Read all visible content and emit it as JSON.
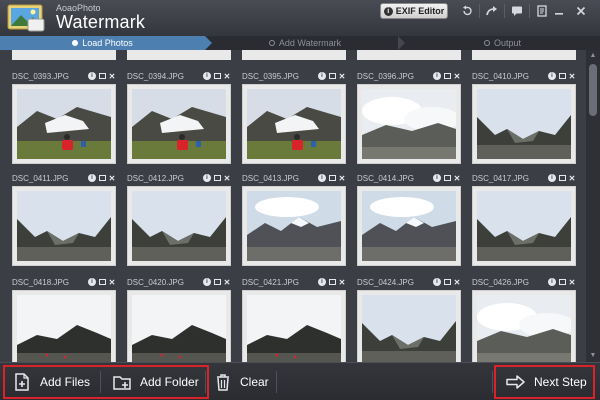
{
  "app": {
    "subtitle": "AoaoPhoto",
    "title": "Watermark"
  },
  "toolbar": {
    "exif_label": "EXIF Editor",
    "exif_icon": "info-icon"
  },
  "steps": [
    {
      "label": "Load Photos",
      "active": true
    },
    {
      "label": "Add Watermark",
      "active": false
    },
    {
      "label": "Output",
      "active": false
    }
  ],
  "photos": [
    {
      "name": "DSC_0393.JPG",
      "scene": "people"
    },
    {
      "name": "DSC_0394.JPG",
      "scene": "people"
    },
    {
      "name": "DSC_0395.JPG",
      "scene": "people"
    },
    {
      "name": "DSC_0396.JPG",
      "scene": "cloud"
    },
    {
      "name": "DSC_0410.JPG",
      "scene": "valley"
    },
    {
      "name": "DSC_0411.JPG",
      "scene": "valley"
    },
    {
      "name": "DSC_0412.JPG",
      "scene": "valley"
    },
    {
      "name": "DSC_0413.JPG",
      "scene": "snow"
    },
    {
      "name": "DSC_0414.JPG",
      "scene": "snow"
    },
    {
      "name": "DSC_0417.JPG",
      "scene": "valley"
    },
    {
      "name": "DSC_0418.JPG",
      "scene": "hill"
    },
    {
      "name": "DSC_0420.JPG",
      "scene": "hill"
    },
    {
      "name": "DSC_0421.JPG",
      "scene": "hill"
    },
    {
      "name": "DSC_0424.JPG",
      "scene": "valley"
    },
    {
      "name": "DSC_0426.JPG",
      "scene": "cloud"
    }
  ],
  "bottom": {
    "add_files": "Add Files",
    "add_folder": "Add Folder",
    "clear": "Clear",
    "next_step": "Next Step"
  },
  "colors": {
    "accent": "#4d7fb0",
    "highlight_box": "#d9232a",
    "background": "#3e4049"
  }
}
